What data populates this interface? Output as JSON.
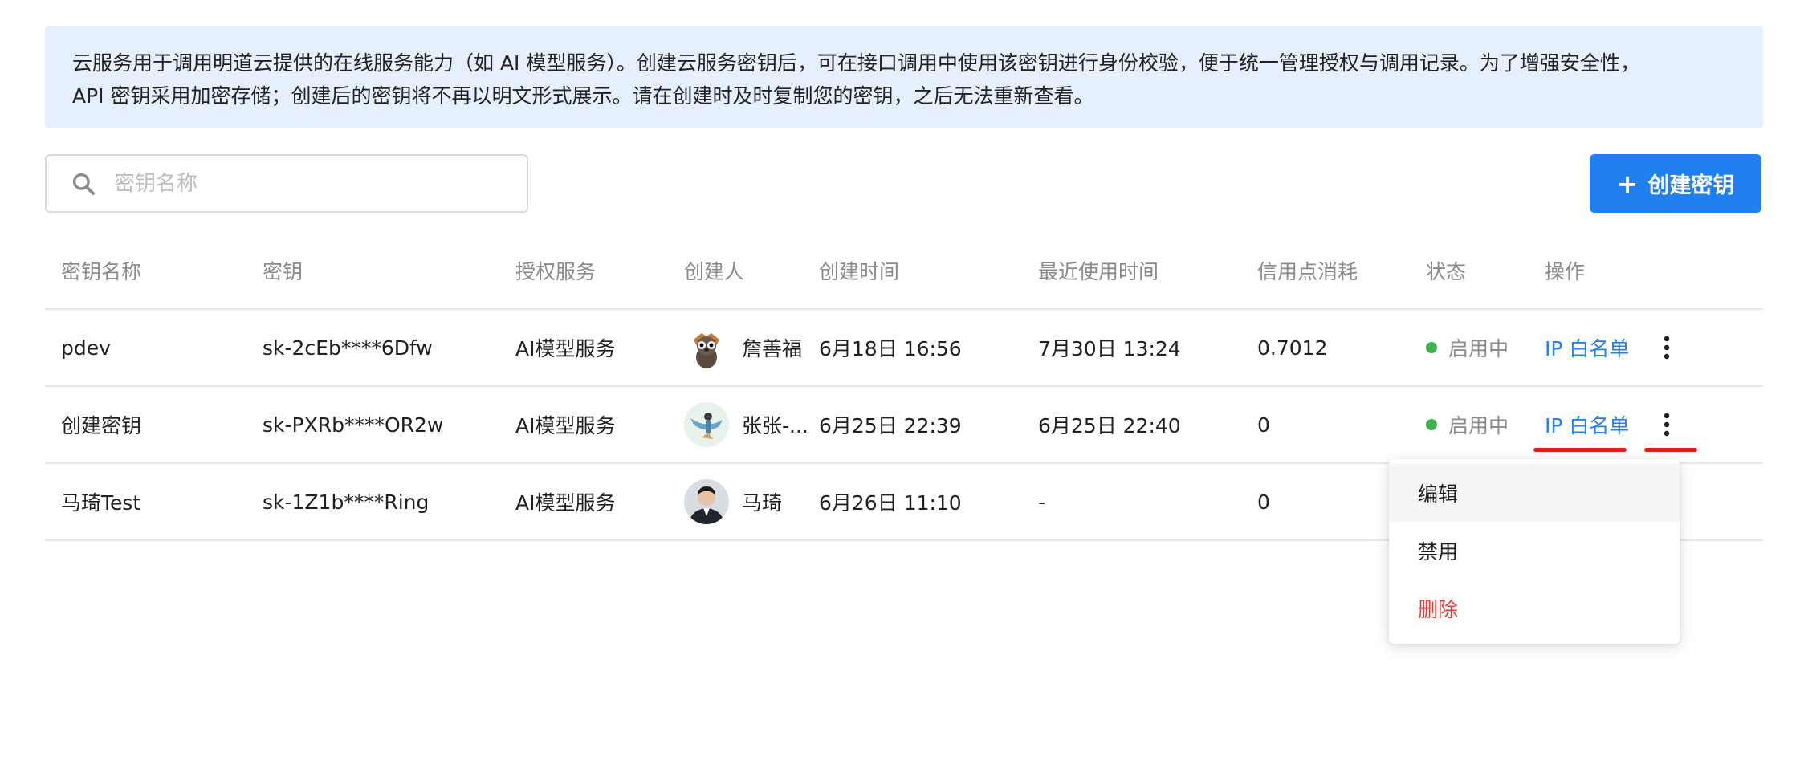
{
  "notice": {
    "line1": "云服务用于调用明道云提供的在线服务能力（如 AI 模型服务）。创建云服务密钥后，可在接口调用中使用该密钥进行身份校验，便于统一管理授权与调用记录。为了增强安全性，",
    "line2": "API 密钥采用加密存储；创建后的密钥将不再以明文形式展示。请在创建时及时复制您的密钥，之后无法重新查看。"
  },
  "search": {
    "placeholder": "密钥名称",
    "value": ""
  },
  "create_button": {
    "label": "创建密钥",
    "icon": "plus-icon"
  },
  "table": {
    "columns": [
      "密钥名称",
      "密钥",
      "授权服务",
      "创建人",
      "创建时间",
      "最近使用时间",
      "信用点消耗",
      "状态",
      "操作"
    ],
    "rows": [
      {
        "name": "pdev",
        "key": "sk-2cEb****6Dfw",
        "service": "AI模型服务",
        "creator": "詹善福",
        "created": "6月18日 16:56",
        "last_used": "7月30日 13:24",
        "credits": "0.7012",
        "status": "启用中",
        "action": "IP 白名单"
      },
      {
        "name": "创建密钥",
        "key": "sk-PXRb****OR2w",
        "service": "AI模型服务",
        "creator": "张张-...",
        "created": "6月25日 22:39",
        "last_used": "6月25日 22:40",
        "credits": "0",
        "status": "启用中",
        "action": "IP 白名单"
      },
      {
        "name": "马琦Test",
        "key": "sk-1Z1b****Ring",
        "service": "AI模型服务",
        "creator": "马琦",
        "created": "6月26日 11:10",
        "last_used": "-",
        "credits": "0",
        "status": "",
        "action": ""
      }
    ]
  },
  "menu": {
    "items": [
      "编辑",
      "禁用",
      "删除"
    ]
  },
  "colors": {
    "primary": "#2080f0",
    "notice_bg": "#e6effd",
    "status_active": "#3fb24f",
    "danger": "#e53935",
    "annotation": "#e41b1b"
  }
}
